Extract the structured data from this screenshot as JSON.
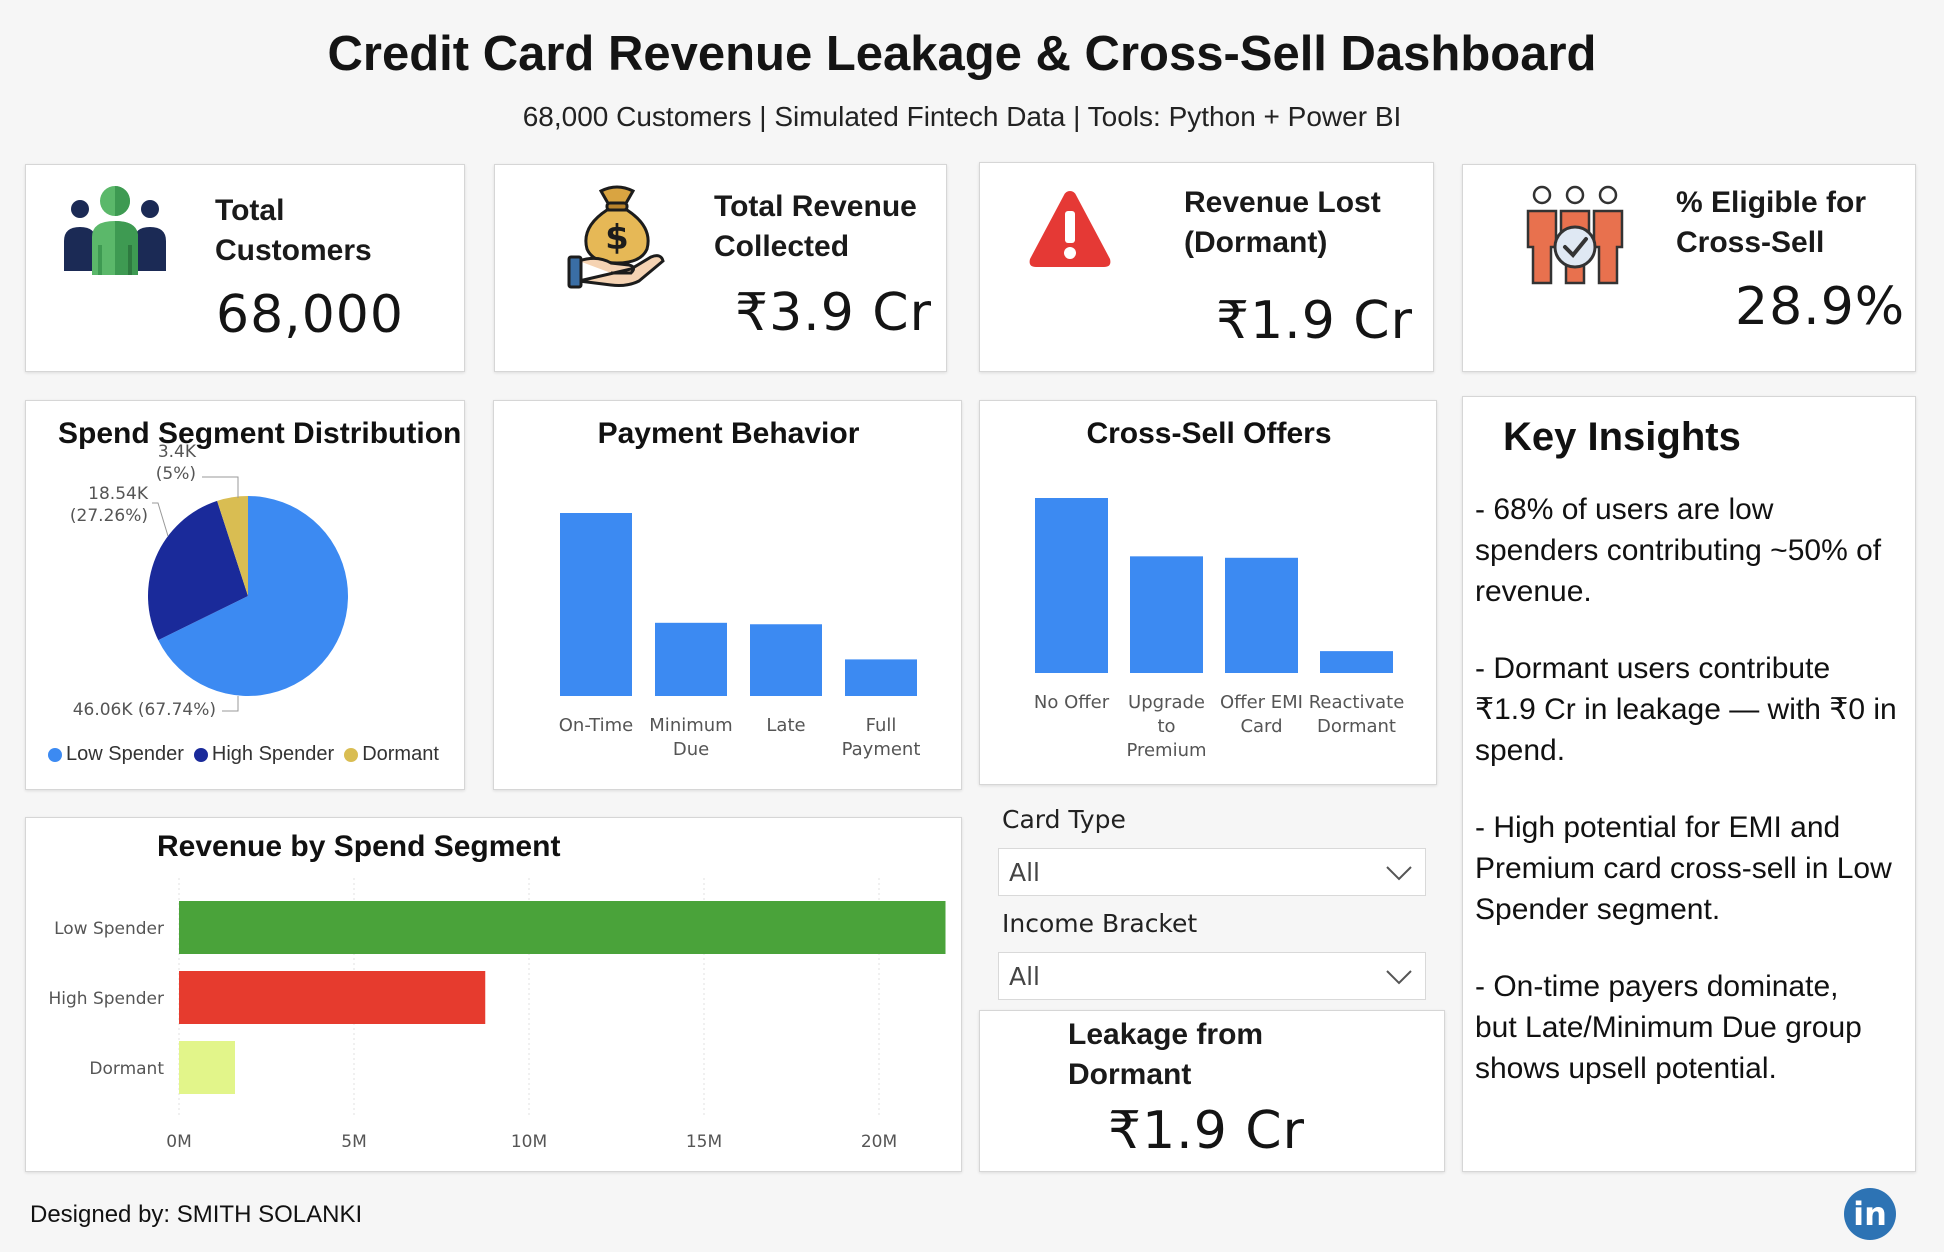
{
  "header": {
    "title": "Credit Card Revenue Leakage & Cross-Sell Dashboard",
    "subtitle": "68,000 Customers | Simulated Fintech Data | Tools: Python + Power BI"
  },
  "kpis": [
    {
      "label_line1": "Total",
      "label_line2": "Customers",
      "value": "68,000",
      "icon": "customers-group-icon"
    },
    {
      "label_line1": "Total Revenue",
      "label_line2": "Collected",
      "value": "₹3.9 Cr",
      "icon": "money-bag-hand-icon"
    },
    {
      "label_line1": "Revenue Lost",
      "label_line2": "(Dormant)",
      "value": "₹1.9 Cr",
      "icon": "warning-triangle-icon"
    },
    {
      "label_line1": "% Eligible for",
      "label_line2": "Cross-Sell",
      "value": "28.9%",
      "icon": "people-check-icon"
    }
  ],
  "colors": {
    "bar_blue": "#3c8af2",
    "low_spender": "#3c8af2",
    "high_spender": "#1a2a9a",
    "dormant": "#d9bd52",
    "seg_low": "#4aa33a",
    "seg_high": "#e63b2e",
    "seg_dormant": "#e2f58a",
    "alert_red": "#e53935",
    "linkedin": "#2d73b4"
  },
  "chart_data": [
    {
      "type": "pie",
      "title": "Spend Segment Distribution",
      "categories": [
        "Low Spender",
        "High Spender",
        "Dormant"
      ],
      "values": [
        46060,
        18540,
        3400
      ],
      "data_labels": [
        {
          "line1": "46.06K (67.74%)",
          "line2": ""
        },
        {
          "line1": "18.54K",
          "line2": "(27.26%)"
        },
        {
          "line1": "3.4K",
          "line2": "(5%)"
        }
      ],
      "legend": [
        "Low Spender",
        "High Spender",
        "Dormant"
      ],
      "legend_position": "bottom"
    },
    {
      "type": "bar",
      "title": "Payment Behavior",
      "categories": [
        [
          "On-Time"
        ],
        [
          "Minimum",
          "Due"
        ],
        [
          "Late"
        ],
        [
          "Full",
          "Payment"
        ]
      ],
      "values": [
        25000,
        10000,
        9800,
        5000
      ],
      "ylim": [
        0,
        25000
      ]
    },
    {
      "type": "bar",
      "title": "Cross-Sell Offers",
      "categories": [
        [
          "No Offer"
        ],
        [
          "Upgrade",
          "to",
          "Premium"
        ],
        [
          "Offer EMI",
          "Card"
        ],
        [
          "Reactivate",
          "Dormant"
        ]
      ],
      "values": [
        24000,
        16000,
        15800,
        3000
      ],
      "ylim": [
        0,
        24000
      ]
    },
    {
      "type": "bar",
      "orientation": "horizontal",
      "title": "Revenue by Spend Segment",
      "categories": [
        "Low Spender",
        "High Spender",
        "Dormant"
      ],
      "values": [
        21900000,
        8750000,
        1600000
      ],
      "xticks": [
        "0M",
        "5M",
        "10M",
        "15M",
        "20M"
      ],
      "xlim": [
        0,
        22000000
      ],
      "grid": true
    }
  ],
  "slicers": [
    {
      "label": "Card Type",
      "value": "All"
    },
    {
      "label": "Income Bracket",
      "value": "All"
    }
  ],
  "leakage_card": {
    "label_line1": "Leakage from",
    "label_line2": "Dormant",
    "value": "₹1.9 Cr"
  },
  "insights": {
    "title": "Key Insights",
    "paragraphs": [
      [
        "- 68% of users are low",
        "spenders contributing ~50% of",
        "revenue."
      ],
      [
        "- Dormant users contribute",
        "₹1.9 Cr in leakage — with ₹0 in",
        "spend."
      ],
      [
        "- High potential for EMI and",
        "Premium card cross-sell in Low",
        "Spender segment."
      ],
      [
        "- On-time payers dominate,",
        "but Late/Minimum Due group",
        "shows upsell potential."
      ]
    ]
  },
  "footer": {
    "designer": "Designed by: SMITH SOLANKI",
    "linkedin_text": "in"
  }
}
